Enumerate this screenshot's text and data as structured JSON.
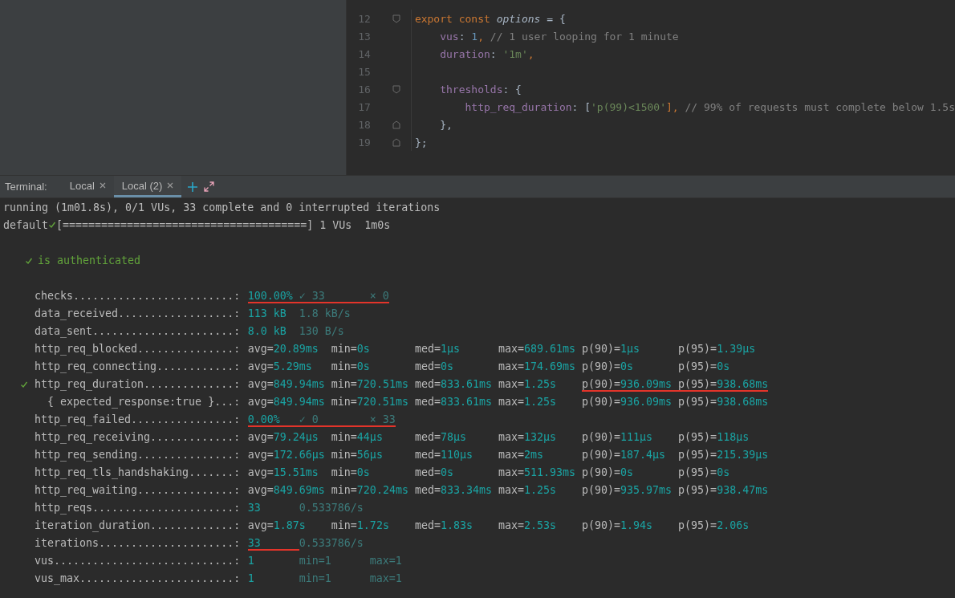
{
  "editor": {
    "lines": [
      {
        "number": "12",
        "kind": "fold_start",
        "tokens": [
          {
            "text": "export const ",
            "kind": "keyword"
          },
          {
            "text": "options",
            "kind": "ident"
          },
          {
            "text": " = {",
            "kind": "plain"
          }
        ]
      },
      {
        "number": "13",
        "kind": "plain",
        "tokens": [
          {
            "text": "    vus",
            "kind": "property"
          },
          {
            "text": ": ",
            "kind": "plain"
          },
          {
            "text": "1",
            "kind": "number"
          },
          {
            "text": ", ",
            "kind": "keyword"
          },
          {
            "text": "// 1 user looping for 1 minute",
            "kind": "comment"
          }
        ]
      },
      {
        "number": "14",
        "kind": "plain",
        "tokens": [
          {
            "text": "    duration",
            "kind": "property"
          },
          {
            "text": ": ",
            "kind": "plain"
          },
          {
            "text": "'1m'",
            "kind": "string"
          },
          {
            "text": ",",
            "kind": "keyword"
          }
        ]
      },
      {
        "number": "15",
        "kind": "plain"
      },
      {
        "number": "16",
        "kind": "fold_start",
        "tokens": [
          {
            "text": "    thresholds",
            "kind": "property"
          },
          {
            "text": ": {",
            "kind": "plain"
          }
        ]
      },
      {
        "number": "17",
        "kind": "plain",
        "tokens": [
          {
            "text": "        http_req_duration",
            "kind": "property"
          },
          {
            "text": ": [",
            "kind": "plain"
          },
          {
            "text": "'p(99)<1500'",
            "kind": "string"
          },
          {
            "text": "], ",
            "kind": "keyword"
          },
          {
            "text": "// 99% of requests must complete below 1.5s",
            "kind": "comment"
          }
        ]
      },
      {
        "number": "18",
        "kind": "fold_end",
        "tokens": [
          {
            "text": "    },",
            "kind": "plain"
          }
        ]
      },
      {
        "number": "19",
        "kind": "fold_end",
        "tokens": [
          {
            "text": "};",
            "kind": "plain"
          }
        ]
      }
    ]
  },
  "terminal": {
    "label": "Terminal:",
    "tabs": [
      {
        "label": "Local",
        "selected": false
      },
      {
        "label": "Local (2)",
        "selected": true
      }
    ],
    "status_line": "running (1m01.8s), 0/1 VUs, 33 complete and 0 interrupted iterations",
    "progress": {
      "scenario": "default",
      "passed": true,
      "bar": "[======================================] 1 VUs  1m0s"
    },
    "check": {
      "passed": true,
      "name": "is authenticated"
    },
    "rows": [
      {
        "label": "checks.........................:",
        "kind": "rate",
        "passed": false,
        "values": [
          {
            "text": "100.00%",
            "kind": "main",
            "underlined": true
          },
          {
            "text": "✓ 33",
            "kind": "dim",
            "underlined": true
          },
          {
            "text": "× 0",
            "kind": "dim",
            "underlined": true
          }
        ]
      },
      {
        "label": "data_received..................:",
        "kind": "rate",
        "passed": false,
        "values": [
          {
            "text": "113 kB",
            "kind": "main",
            "underlined": false
          },
          {
            "text": "1.8 kB/s",
            "kind": "dim",
            "underlined": false
          }
        ]
      },
      {
        "label": "data_sent......................:",
        "kind": "rate",
        "passed": false,
        "values": [
          {
            "text": "8.0 kB",
            "kind": "main",
            "underlined": false
          },
          {
            "text": "130 B/s",
            "kind": "dim",
            "underlined": false
          }
        ]
      },
      {
        "label": "http_req_blocked...............:",
        "kind": "stats",
        "passed": false,
        "values": [
          {
            "key": "avg=",
            "text": "20.89ms",
            "kind": "stat",
            "underlined": false
          },
          {
            "key": "min=",
            "text": "0s",
            "kind": "stat",
            "underlined": false
          },
          {
            "key": "med=",
            "text": "1µs",
            "kind": "stat",
            "underlined": false
          },
          {
            "key": "max=",
            "text": "689.61ms",
            "kind": "stat",
            "underlined": false
          },
          {
            "key": "p(90)=",
            "text": "1µs",
            "kind": "stat",
            "underlined": false
          },
          {
            "key": "p(95)=",
            "text": "1.39µs",
            "kind": "stat",
            "underlined": false
          }
        ]
      },
      {
        "label": "http_req_connecting............:",
        "kind": "stats",
        "passed": false,
        "values": [
          {
            "key": "avg=",
            "text": "5.29ms",
            "kind": "stat",
            "underlined": false
          },
          {
            "key": "min=",
            "text": "0s",
            "kind": "stat",
            "underlined": false
          },
          {
            "key": "med=",
            "text": "0s",
            "kind": "stat",
            "underlined": false
          },
          {
            "key": "max=",
            "text": "174.69ms",
            "kind": "stat",
            "underlined": false
          },
          {
            "key": "p(90)=",
            "text": "0s",
            "kind": "stat",
            "underlined": false
          },
          {
            "key": "p(95)=",
            "text": "0s",
            "kind": "stat",
            "underlined": false
          }
        ]
      },
      {
        "label": "http_req_duration..............:",
        "kind": "stats",
        "passed": true,
        "values": [
          {
            "key": "avg=",
            "text": "849.94ms",
            "kind": "stat",
            "underlined": false
          },
          {
            "key": "min=",
            "text": "720.51ms",
            "kind": "stat",
            "underlined": false
          },
          {
            "key": "med=",
            "text": "833.61ms",
            "kind": "stat",
            "underlined": false
          },
          {
            "key": "max=",
            "text": "1.25s",
            "kind": "stat",
            "underlined": false
          },
          {
            "key": "p(90)=",
            "text": "936.09ms",
            "kind": "stat",
            "underlined": true
          },
          {
            "key": "p(95)=",
            "text": "938.68ms",
            "kind": "stat",
            "underlined": true
          }
        ],
        "children": [
          {
            "label": "{ expected_response:true }...:",
            "kind": "stats",
            "passed": false,
            "values": [
              {
                "key": "avg=",
                "text": "849.94ms",
                "kind": "stat",
                "underlined": false
              },
              {
                "key": "min=",
                "text": "720.51ms",
                "kind": "stat",
                "underlined": false
              },
              {
                "key": "med=",
                "text": "833.61ms",
                "kind": "stat",
                "underlined": false
              },
              {
                "key": "max=",
                "text": "1.25s",
                "kind": "stat",
                "underlined": false
              },
              {
                "key": "p(90)=",
                "text": "936.09ms",
                "kind": "stat",
                "underlined": false
              },
              {
                "key": "p(95)=",
                "text": "938.68ms",
                "kind": "stat",
                "underlined": false
              }
            ]
          }
        ]
      },
      {
        "label": "http_req_failed................:",
        "kind": "rate",
        "passed": false,
        "values": [
          {
            "text": "0.00%",
            "kind": "main",
            "underlined": true
          },
          {
            "text": "✓ 0",
            "kind": "dim",
            "underlined": true
          },
          {
            "text": "× 33",
            "kind": "dim",
            "underlined": true
          }
        ]
      },
      {
        "label": "http_req_receiving.............:",
        "kind": "stats",
        "passed": false,
        "values": [
          {
            "key": "avg=",
            "text": "79.24µs",
            "kind": "stat",
            "underlined": false
          },
          {
            "key": "min=",
            "text": "44µs",
            "kind": "stat",
            "underlined": false
          },
          {
            "key": "med=",
            "text": "78µs",
            "kind": "stat",
            "underlined": false
          },
          {
            "key": "max=",
            "text": "132µs",
            "kind": "stat",
            "underlined": false
          },
          {
            "key": "p(90)=",
            "text": "111µs",
            "kind": "stat",
            "underlined": false
          },
          {
            "key": "p(95)=",
            "text": "118µs",
            "kind": "stat",
            "underlined": false
          }
        ]
      },
      {
        "label": "http_req_sending...............:",
        "kind": "stats",
        "passed": false,
        "values": [
          {
            "key": "avg=",
            "text": "172.66µs",
            "kind": "stat",
            "underlined": false
          },
          {
            "key": "min=",
            "text": "56µs",
            "kind": "stat",
            "underlined": false
          },
          {
            "key": "med=",
            "text": "110µs",
            "kind": "stat",
            "underlined": false
          },
          {
            "key": "max=",
            "text": "2ms",
            "kind": "stat",
            "underlined": false
          },
          {
            "key": "p(90)=",
            "text": "187.4µs",
            "kind": "stat",
            "underlined": false
          },
          {
            "key": "p(95)=",
            "text": "215.39µs",
            "kind": "stat",
            "underlined": false
          }
        ]
      },
      {
        "label": "http_req_tls_handshaking.......:",
        "kind": "stats",
        "passed": false,
        "values": [
          {
            "key": "avg=",
            "text": "15.51ms",
            "kind": "stat",
            "underlined": false
          },
          {
            "key": "min=",
            "text": "0s",
            "kind": "stat",
            "underlined": false
          },
          {
            "key": "med=",
            "text": "0s",
            "kind": "stat",
            "underlined": false
          },
          {
            "key": "max=",
            "text": "511.93ms",
            "kind": "stat",
            "underlined": false
          },
          {
            "key": "p(90)=",
            "text": "0s",
            "kind": "stat",
            "underlined": false
          },
          {
            "key": "p(95)=",
            "text": "0s",
            "kind": "stat",
            "underlined": false
          }
        ]
      },
      {
        "label": "http_req_waiting...............:",
        "kind": "stats",
        "passed": false,
        "values": [
          {
            "key": "avg=",
            "text": "849.69ms",
            "kind": "stat",
            "underlined": false
          },
          {
            "key": "min=",
            "text": "720.24ms",
            "kind": "stat",
            "underlined": false
          },
          {
            "key": "med=",
            "text": "833.34ms",
            "kind": "stat",
            "underlined": false
          },
          {
            "key": "max=",
            "text": "1.25s",
            "kind": "stat",
            "underlined": false
          },
          {
            "key": "p(90)=",
            "text": "935.97ms",
            "kind": "stat",
            "underlined": false
          },
          {
            "key": "p(95)=",
            "text": "938.47ms",
            "kind": "stat",
            "underlined": false
          }
        ]
      },
      {
        "label": "http_reqs......................:",
        "kind": "rate",
        "passed": false,
        "values": [
          {
            "text": "33",
            "kind": "main",
            "underlined": false
          },
          {
            "text": "0.533786/s",
            "kind": "dim",
            "underlined": false
          }
        ]
      },
      {
        "label": "iteration_duration.............:",
        "kind": "stats",
        "passed": false,
        "values": [
          {
            "key": "avg=",
            "text": "1.87s",
            "kind": "stat",
            "underlined": false
          },
          {
            "key": "min=",
            "text": "1.72s",
            "kind": "stat",
            "underlined": false
          },
          {
            "key": "med=",
            "text": "1.83s",
            "kind": "stat",
            "underlined": false
          },
          {
            "key": "max=",
            "text": "2.53s",
            "kind": "stat",
            "underlined": false
          },
          {
            "key": "p(90)=",
            "text": "1.94s",
            "kind": "stat",
            "underlined": false
          },
          {
            "key": "p(95)=",
            "text": "2.06s",
            "kind": "stat",
            "underlined": false
          }
        ]
      },
      {
        "label": "iterations.....................:",
        "kind": "rate",
        "passed": false,
        "values": [
          {
            "text": "33",
            "kind": "main",
            "underlined": true
          },
          {
            "text": "0.533786/s",
            "kind": "dim",
            "underlined": false
          }
        ]
      },
      {
        "label": "vus............................:",
        "kind": "rate",
        "passed": false,
        "values": [
          {
            "text": "1",
            "kind": "main",
            "underlined": false
          },
          {
            "text": "min=1",
            "kind": "dim",
            "underlined": false
          },
          {
            "text": "max=1",
            "kind": "dim",
            "underlined": false
          }
        ]
      },
      {
        "label": "vus_max........................:",
        "kind": "rate",
        "passed": false,
        "values": [
          {
            "text": "1",
            "kind": "main",
            "underlined": false
          },
          {
            "text": "min=1",
            "kind": "dim",
            "underlined": false
          },
          {
            "text": "max=1",
            "kind": "dim",
            "underlined": false
          }
        ]
      }
    ]
  }
}
